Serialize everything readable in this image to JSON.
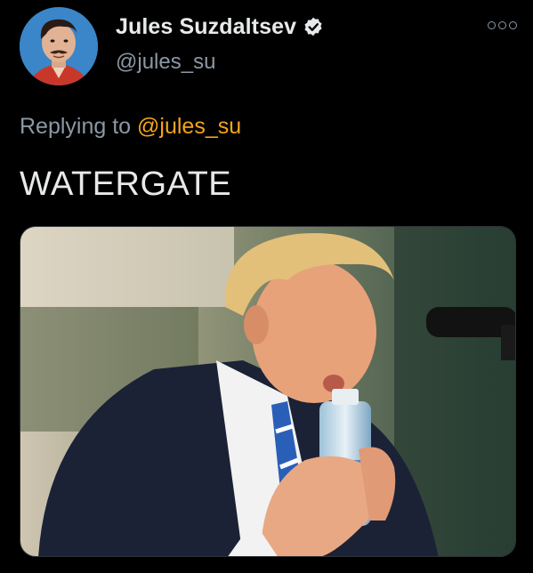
{
  "author": {
    "display_name": "Jules Suzdaltsev",
    "handle": "@jules_su",
    "verified": true
  },
  "reply_context": {
    "prefix": "Replying to",
    "handle": "@jules_su"
  },
  "tweet": {
    "text": "WATERGATE"
  },
  "icons": {
    "verified": "verified-badge-icon",
    "more": "more-options-icon"
  },
  "colors": {
    "background": "#000000",
    "primary_text": "#e7e9ea",
    "secondary_text": "#8b98a5",
    "accent": "#f4a51c"
  }
}
